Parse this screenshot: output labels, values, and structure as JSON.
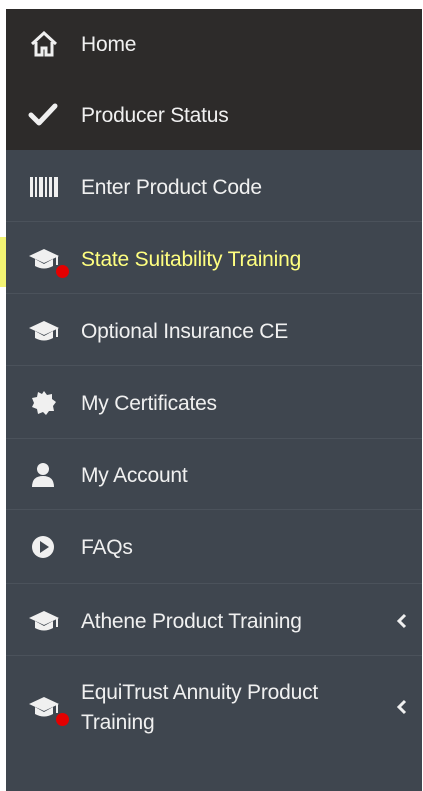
{
  "colors": {
    "sidebar_bg": "#3f464f",
    "top_block_bg": "#2d2b2a",
    "text": "#f0f0f0",
    "highlight": "#e8ea00",
    "notification_dot": "#e30000"
  },
  "sidebar": {
    "items": [
      {
        "label": "Home",
        "icon": "home-icon"
      },
      {
        "label": "Producer Status",
        "icon": "checkmark-icon"
      },
      {
        "label": "Enter Product Code",
        "icon": "barcode-icon"
      },
      {
        "label": "State Suitability Training",
        "icon": "graduation-cap-icon",
        "highlighted": true,
        "notification_dot": true
      },
      {
        "label": "Optional Insurance CE",
        "icon": "graduation-cap-icon"
      },
      {
        "label": "My Certificates",
        "icon": "certificate-icon"
      },
      {
        "label": "My Account",
        "icon": "user-icon"
      },
      {
        "label": "FAQs",
        "icon": "play-circle-icon"
      },
      {
        "label": "Athene Product Training",
        "icon": "graduation-cap-icon",
        "submenu": true
      },
      {
        "label": "EquiTrust Annuity Product Training",
        "icon": "graduation-cap-icon",
        "submenu": true,
        "notification_dot": true
      }
    ]
  }
}
